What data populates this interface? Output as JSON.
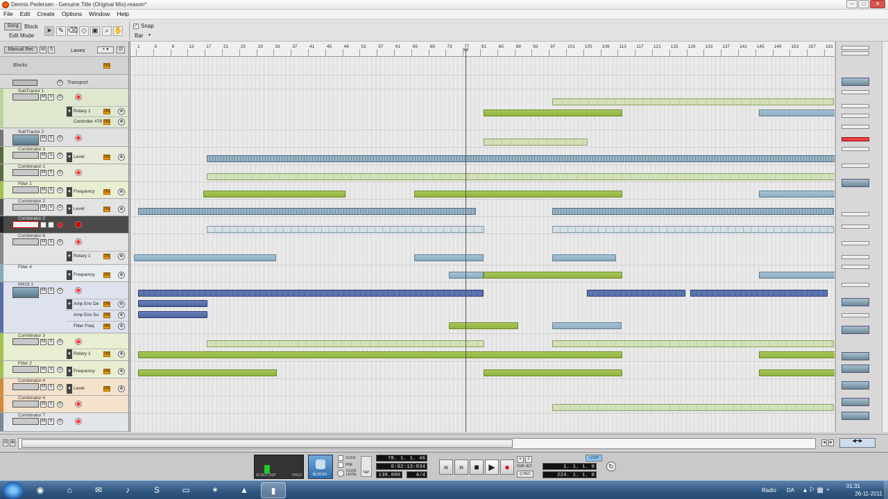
{
  "window": {
    "title": "Dennis Pedersen - Genuine Title (Original Mix).reason*",
    "min": "–",
    "max": "□",
    "close": "✕"
  },
  "menu": [
    "File",
    "Edit",
    "Create",
    "Options",
    "Window",
    "Help"
  ],
  "toolbar": {
    "song_label": "Song",
    "block_label": "Block",
    "edit_mode_label": "Edit Mode",
    "snap_label": "Snap",
    "snap_value": "Bar",
    "tools": [
      "select-arrow",
      "pencil",
      "eraser",
      "razor",
      "mute",
      "zoom",
      "hand"
    ]
  },
  "lanes_header": {
    "manual_rec": "Manual Rec",
    "lanes_label": "Lanes"
  },
  "tracks": {
    "blocks": "Blocks",
    "transport": "Transport",
    "t1": "SubTractor 1",
    "t1_lane1": "Rotary 1",
    "t1_lane2": "Controller #79",
    "t2": "SubTractor 2",
    "t3": "Combinator 1",
    "t3_lane1": "Level",
    "t4": "Combinator 1",
    "t5": "Filter 1",
    "t5_lane1": "Frequency",
    "t6": "Combinator 2",
    "t6_lane1": "Level",
    "t7": "Combinator 2",
    "t8": "Combinator 6",
    "t8_lane1": "Rotary 1",
    "t9": "Filter 4",
    "t9_lane1": "Frequency",
    "t10": "NN19 1",
    "t10_lane1": "Amp Env De",
    "t10_lane2": "Amp Env Su",
    "t10_lane3": "Filter Freq",
    "t11": "Combinator 3",
    "t11_lane1": "Rotary 1",
    "t12": "Filter 2",
    "t12_lane1": "Frequency",
    "t13": "Combinator 4",
    "t13_lane1": "Level",
    "t14": "Combinator 4",
    "t15": "Combinator 7"
  },
  "lane_controls": {
    "m": "M",
    "s": "S",
    "on": "ON"
  },
  "ruler": [
    "1",
    "5",
    "9",
    "13",
    "17",
    "21",
    "25",
    "29",
    "33",
    "37",
    "41",
    "45",
    "49",
    "53",
    "57",
    "61",
    "65",
    "69",
    "73",
    "77",
    "81",
    "85",
    "89",
    "93",
    "97",
    "101",
    "105",
    "109",
    "113",
    "117",
    "121",
    "125",
    "129",
    "133",
    "137",
    "141",
    "145",
    "149",
    "153",
    "157",
    "161"
  ],
  "transport": {
    "in_out_dsp": "IN OUT DSP",
    "ohlo": "OHLO",
    "blocks_btn": "BLOCKS",
    "click": "CLICK",
    "pre": "PRE",
    "click_level": "CLICK LEVEL",
    "tap": "TAP",
    "position_bars": "78. 1. 1. 46",
    "position_time": "0:02:13:934",
    "tempo": "138.000",
    "signature": "4/4",
    "dub": "DUB",
    "alt": "ALT",
    "q_rec": "Q REC",
    "loop_label": "LOOP",
    "loop_left": "1. 1. 1.   0",
    "loop_right": "224. 1. 1.   0"
  },
  "taskbar": {
    "lang_label": "Radio",
    "lang": "DA",
    "time": "01:31",
    "date": "26-11-2011"
  }
}
